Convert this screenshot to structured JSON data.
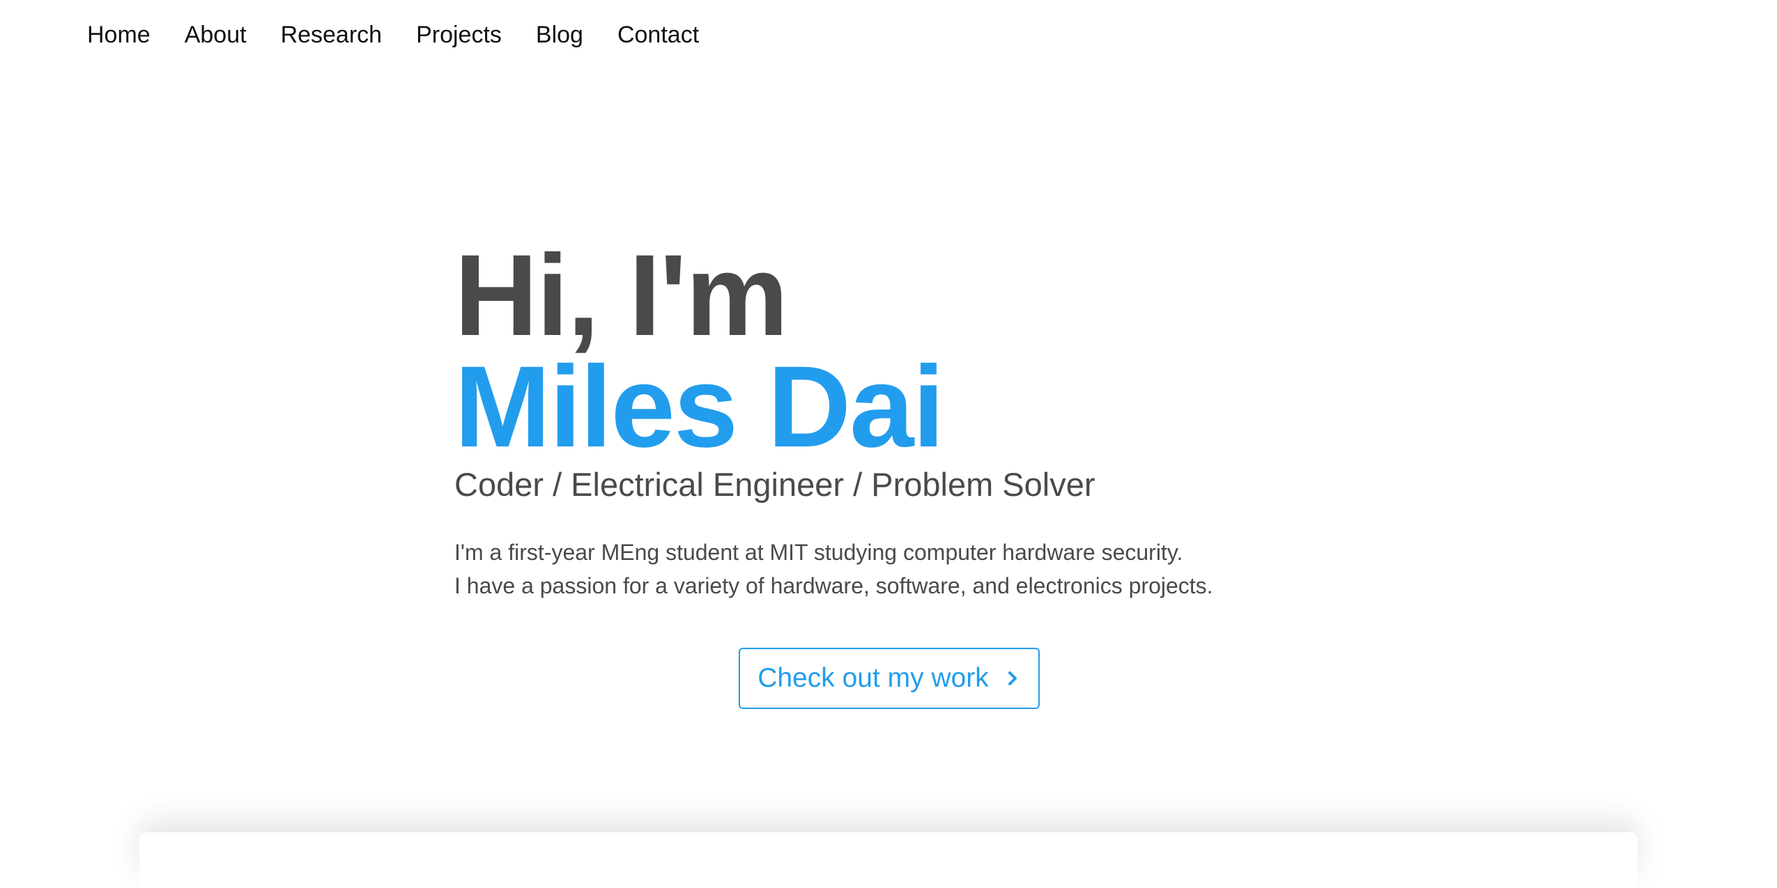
{
  "nav": {
    "items": [
      {
        "label": "Home"
      },
      {
        "label": "About"
      },
      {
        "label": "Research"
      },
      {
        "label": "Projects"
      },
      {
        "label": "Blog"
      },
      {
        "label": "Contact"
      }
    ]
  },
  "hero": {
    "greeting": "Hi, I'm",
    "name": "Miles Dai",
    "tagline": "Coder / Electrical Engineer / Problem Solver",
    "bio_line_1": "I'm a first-year MEng student at MIT studying computer hardware security.",
    "bio_line_2": "I have a passion for a variety of hardware, software, and electronics projects."
  },
  "cta": {
    "label": "Check out my work",
    "icon": "chevron-right-icon"
  },
  "colors": {
    "accent": "#229ded",
    "text_dark": "#4a4a4a",
    "nav_text": "#111111"
  }
}
